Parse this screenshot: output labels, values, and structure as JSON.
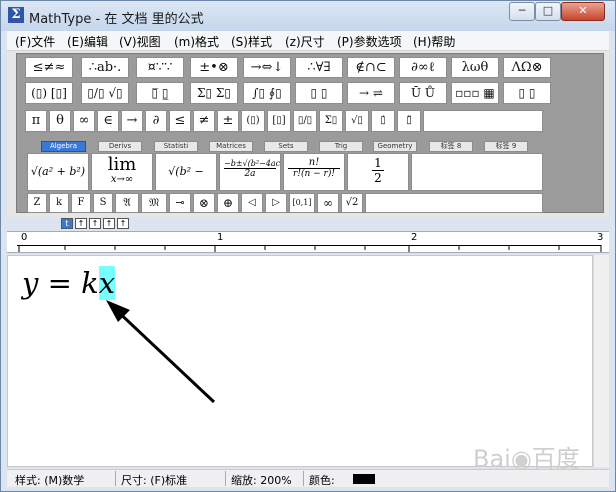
{
  "window": {
    "title": "MathType - 在 文档 里的公式"
  },
  "menu": [
    "(F)文件",
    "(E)编辑",
    "(V)视图",
    "(m)格式",
    "(S)样式",
    "(z)尺寸",
    "(P)参数选项",
    "(H)帮助"
  ],
  "symbol_row1": [
    "≤≠≈",
    "∴ab·.",
    "¤∵∵",
    "±•⊗",
    "→⇔↓",
    "∴∀∃",
    "∉∩⊂",
    "∂∞ℓ",
    "λωθ",
    "ΛΩ⊗"
  ],
  "template_row2": [
    "(▯) [▯]",
    "▯/▯ √▯",
    "▯̅ ▯̲",
    "Σ▯ Σ▯",
    "∫▯ ∮▯",
    "▯ ▯",
    "→ ⇌",
    "Ū Ů",
    "▫▫▫ ▦",
    "▯ ▯"
  ],
  "symbol_row3": [
    "π",
    "θ",
    "∞",
    "∈",
    "→",
    "∂",
    "≤",
    "≠",
    "±",
    "(▯)",
    "[▯]",
    "▯/▯",
    "Σ▯",
    "√▯",
    "▯̇",
    "▯̈"
  ],
  "tabs": [
    "Algebra",
    "Derivs",
    "Statisti",
    "Matrices",
    "Sets",
    "Trig",
    "Geometry",
    "标签 8",
    "标签 9"
  ],
  "templates": {
    "t1": "√(a² + b²)",
    "t2_top": "lim",
    "t2_sub": "x→∞",
    "t3": "√(b² − 4ac)",
    "t4_num": "−b±√(b²−4ac)",
    "t4_den": "2a",
    "t5_num": "n!",
    "t5_den": "r!(n − r)!",
    "t6_num": "1",
    "t6_den": "2"
  },
  "row5": [
    "Z",
    "k",
    "F",
    "S",
    "𝔄",
    "𝔐",
    "⊸",
    "⊗",
    "⊕",
    "◁",
    "▷",
    "[0,1]",
    "∞",
    "√2"
  ],
  "mini_toolbar": [
    "t",
    "↑",
    "↑",
    "↑",
    "↑"
  ],
  "ruler_labels": [
    "0",
    "1",
    "2",
    "3"
  ],
  "equation": {
    "left": "y",
    "eq": "=",
    "k": "k",
    "x": "x"
  },
  "status": {
    "style": "样式: (M)数学",
    "size": "尺寸: (F)标准",
    "zoom": "缩放: 200%",
    "color": "颜色:"
  },
  "colors": {
    "highlight": "#7ffcff",
    "arrow": "#000000",
    "active_tab": "#3a78d8"
  }
}
